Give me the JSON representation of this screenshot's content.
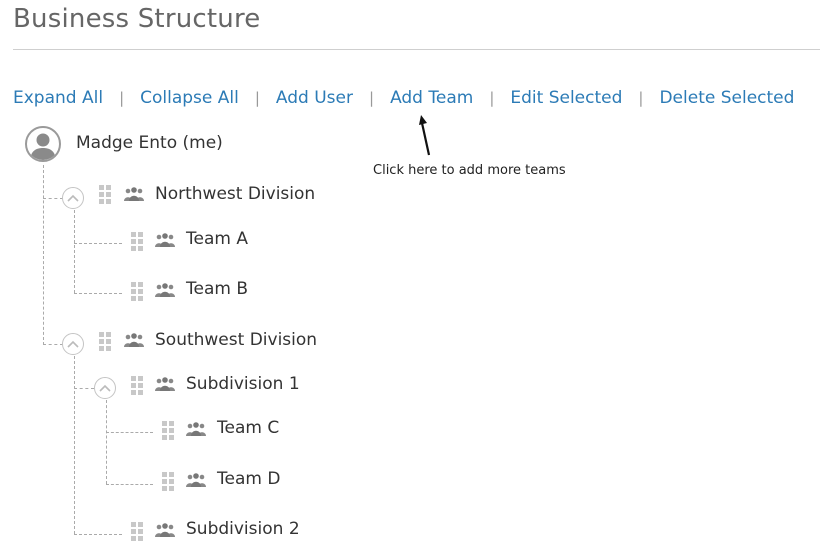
{
  "page": {
    "title": "Business Structure"
  },
  "toolbar": {
    "expand_all": "Expand All",
    "collapse_all": "Collapse All",
    "add_user": "Add User",
    "add_team": "Add Team",
    "edit_selected": "Edit Selected",
    "delete_selected": "Delete Selected",
    "separator": "|"
  },
  "callout": {
    "text": "Click here to add more teams"
  },
  "tree": {
    "root": {
      "name": "Madge Ento (me)",
      "icon": "user-avatar-icon"
    },
    "northwest": {
      "label": "Northwest Division",
      "expanded": true
    },
    "team_a": {
      "label": "Team A"
    },
    "team_b": {
      "label": "Team B"
    },
    "southwest": {
      "label": "Southwest Division",
      "expanded": true
    },
    "subdivision_1": {
      "label": "Subdivision 1",
      "expanded": true
    },
    "team_c": {
      "label": "Team C"
    },
    "team_d": {
      "label": "Team D"
    },
    "subdivision_2": {
      "label": "Subdivision 2"
    }
  },
  "colors": {
    "link": "#2c7bb6",
    "title": "#666666",
    "tree_line": "#aaaaaa"
  }
}
